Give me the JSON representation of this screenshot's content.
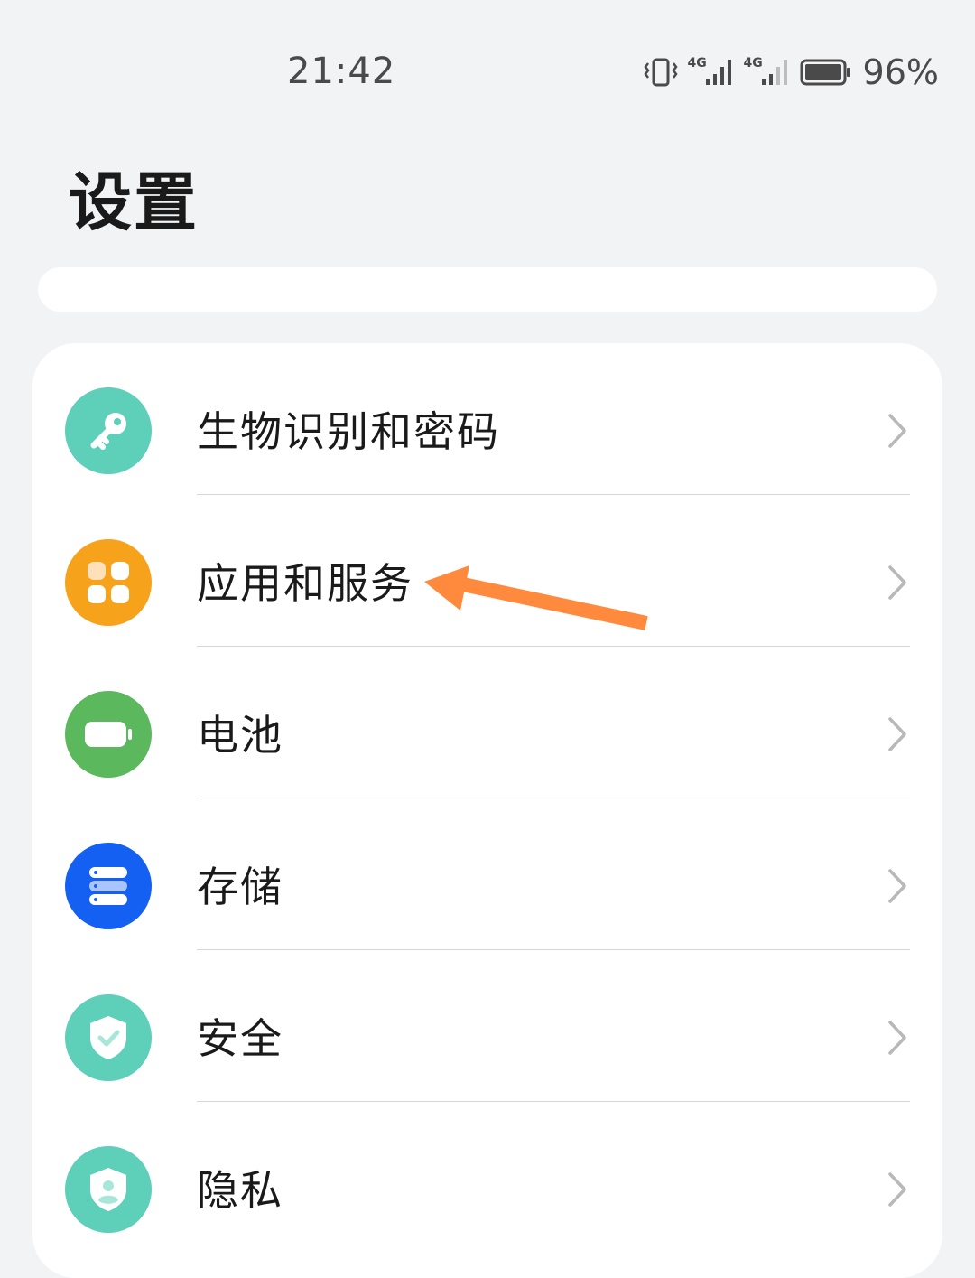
{
  "status_bar": {
    "time": "21:42",
    "battery_percent": "96%",
    "network_1": "4G",
    "network_2": "4G",
    "icons": [
      "vibrate-icon",
      "signal-4g-icon",
      "signal-4g-icon",
      "battery-icon"
    ]
  },
  "header": {
    "title": "设置"
  },
  "search": {
    "placeholder": ""
  },
  "settings": {
    "items": [
      {
        "label": "生物识别和密码",
        "icon": "key-icon",
        "color": "#5ecfb8"
      },
      {
        "label": "应用和服务",
        "icon": "apps-grid-icon",
        "color": "#f7a21b"
      },
      {
        "label": "电池",
        "icon": "battery-icon",
        "color": "#5cb85c"
      },
      {
        "label": "存储",
        "icon": "storage-icon",
        "color": "#1460f2"
      },
      {
        "label": "安全",
        "icon": "shield-check-icon",
        "color": "#5ecfb8"
      },
      {
        "label": "隐私",
        "icon": "privacy-shield-icon",
        "color": "#5ecfb8"
      }
    ]
  },
  "annotation": {
    "color": "#ff8a3d",
    "target": "应用和服务"
  }
}
